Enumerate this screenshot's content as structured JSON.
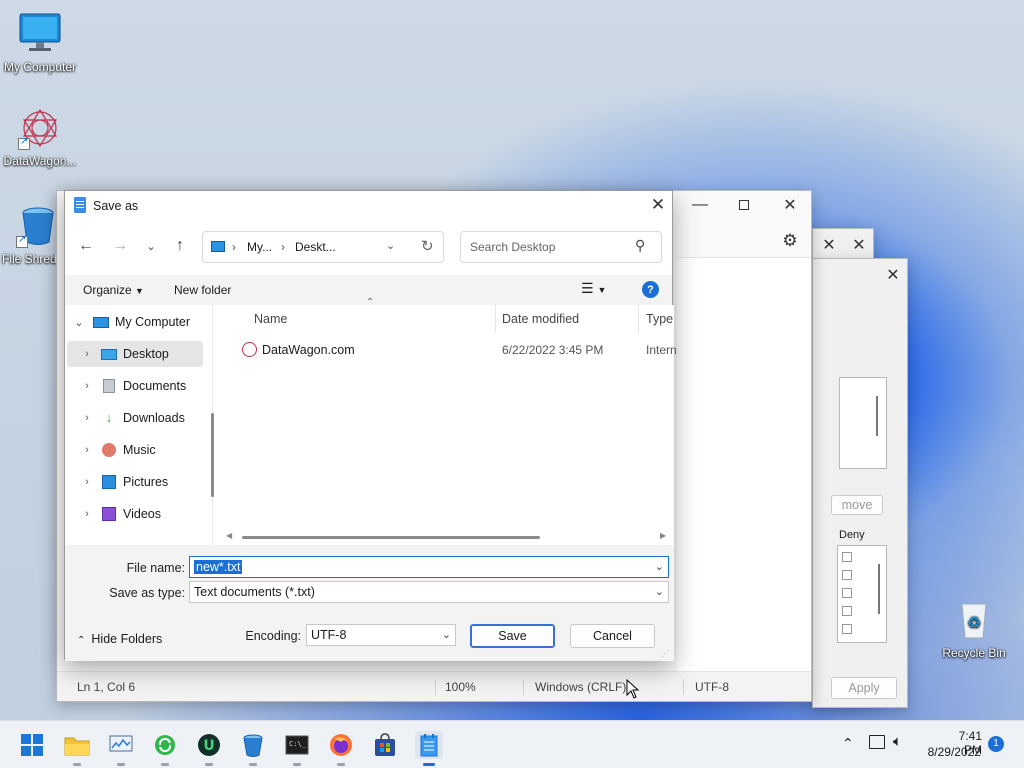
{
  "desktop": {
    "icons": [
      {
        "label": "My Computer",
        "icon": "monitor-icon"
      },
      {
        "label": "DataWagon...",
        "icon": "datawagon-icon"
      },
      {
        "label": "File Shred",
        "icon": "bucket-icon"
      },
      {
        "label": "Recycle Bin",
        "icon": "recycle-bin-icon"
      }
    ]
  },
  "notepad": {
    "status": {
      "position": "Ln 1, Col 6",
      "zoom": "100%",
      "line_ending": "Windows (CRLF)",
      "encoding": "UTF-8"
    }
  },
  "bg_window": {
    "remove_button": "move",
    "deny_label": "Deny",
    "apply_button": "Apply"
  },
  "dialog": {
    "title": "Save as",
    "address": {
      "crumbs": [
        "My...",
        "Deskt..."
      ]
    },
    "search_placeholder": "Search Desktop",
    "toolbar": {
      "organize": "Organize",
      "new_folder": "New folder"
    },
    "tree": [
      {
        "label": "My Computer",
        "icon": "computer-icon",
        "expanded": true
      },
      {
        "label": "Desktop",
        "icon": "desktop-folder-icon",
        "selected": true
      },
      {
        "label": "Documents",
        "icon": "documents-icon"
      },
      {
        "label": "Downloads",
        "icon": "downloads-icon"
      },
      {
        "label": "Music",
        "icon": "music-icon"
      },
      {
        "label": "Pictures",
        "icon": "pictures-icon"
      },
      {
        "label": "Videos",
        "icon": "videos-icon"
      }
    ],
    "columns": [
      "Name",
      "Date modified",
      "Type"
    ],
    "files": [
      {
        "name": "DataWagon.com",
        "date": "6/22/2022 3:45 PM",
        "type": "Intern"
      }
    ],
    "file_name_label": "File name:",
    "file_name_value": "new*.txt",
    "save_type_label": "Save as type:",
    "save_type_value": "Text documents (*.txt)",
    "hide_folders": "Hide Folders",
    "encoding_label": "Encoding:",
    "encoding_value": "UTF-8",
    "save_button": "Save",
    "cancel_button": "Cancel"
  },
  "taskbar": {
    "apps": [
      "start-icon",
      "file-explorer-icon",
      "monitor-chart-icon",
      "green-refresh-icon",
      "upwork-icon",
      "bucket-icon",
      "terminal-icon",
      "firefox-icon",
      "store-icon",
      "notepad-icon"
    ],
    "time": "7:41 PM",
    "date": "8/29/2022",
    "notification_count": "1"
  }
}
